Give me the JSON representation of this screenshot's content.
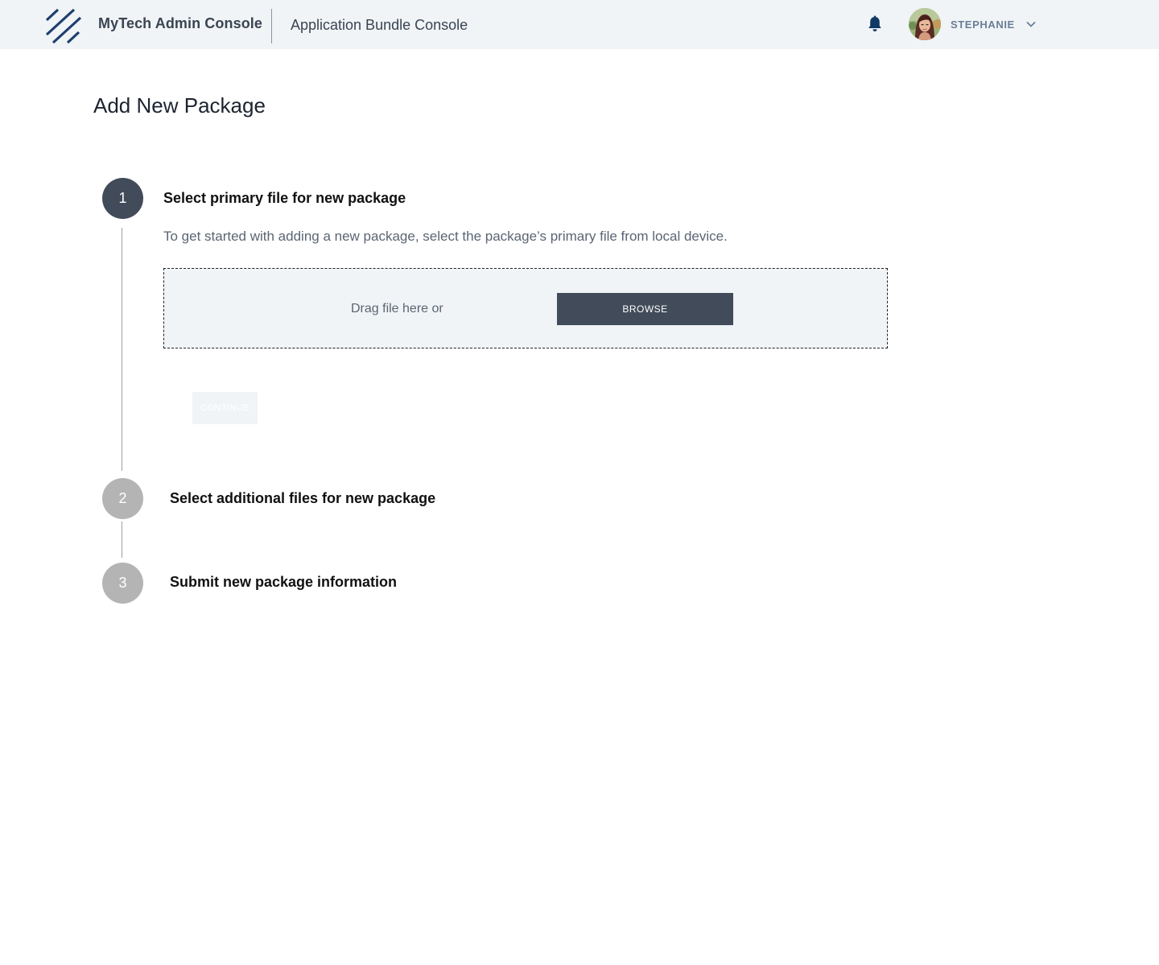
{
  "header": {
    "brand": "MyTech Admin Console",
    "app_name": "Application Bundle Console",
    "user": {
      "name": "STEPHANIE"
    },
    "icons": {
      "logo": "logo-stripes-icon",
      "notifications": "bell-icon",
      "user_menu": "chevron-down-icon"
    }
  },
  "page": {
    "title": "Add New Package"
  },
  "steps": [
    {
      "number": "1",
      "title": "Select primary file for new package",
      "state": "active",
      "description": "To get started with adding a new package,  select the package’s primary file from local device.",
      "dropzone": {
        "text": "Drag file here or",
        "browse_label": "BROWSE"
      },
      "continue_label": "CONTINUE",
      "continue_enabled": false
    },
    {
      "number": "2",
      "title": "Select additional files for new package",
      "state": "inactive"
    },
    {
      "number": "3",
      "title": "Submit new package information",
      "state": "inactive"
    }
  ],
  "colors": {
    "header_bg": "#f0f4f7",
    "primary": "#414b59",
    "inactive_step": "#b4b4b4",
    "brand_blue": "#1f3f6e",
    "bell": "#0f3a63",
    "username": "#6b7e96"
  }
}
